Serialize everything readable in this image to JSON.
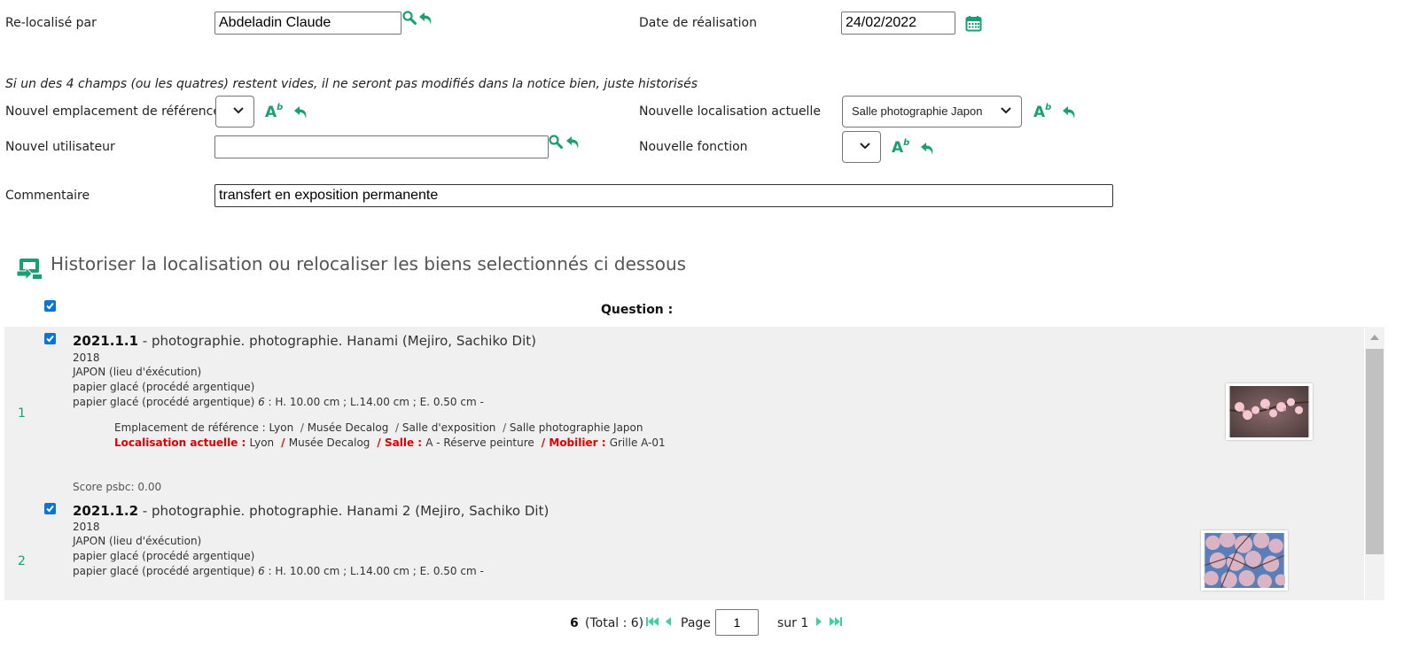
{
  "form": {
    "relocalise_label": "Re-localisé par",
    "relocalise_value": "Abdeladin Claude",
    "date_label": "Date de réalisation",
    "date_value": "24/02/2022",
    "note": "Si un des 4 champs (ou les quatres) restent vides, il ne seront pas modifiés dans la notice bien, juste historisés",
    "emplacement_label": "Nouvel emplacement de référence",
    "emplacement_value": "",
    "localisation_label": "Nouvelle localisation actuelle",
    "localisation_value": "Salle photographie Japon",
    "utilisateur_label": "Nouvel utilisateur",
    "utilisateur_value": "",
    "fonction_label": "Nouvelle fonction",
    "fonction_value": "",
    "commentaire_label": "Commentaire",
    "commentaire_value": "transfert en exposition permanente"
  },
  "section": {
    "title": "Historiser la localisation ou relocaliser les biens selectionnés ci dessous",
    "column_header": "Question :"
  },
  "items": [
    {
      "num": "1",
      "code": "2021.1.1",
      "desc": " - photographie. photographie. Hanami (Mejiro, Sachiko Dit)",
      "year": "2018",
      "place": "JAPON (lieu d'éxécution)",
      "material": "papier glacé (procédé argentique)",
      "dims_prefix": "papier glacé (procédé argentique) ",
      "dims_count": "6",
      "dims_rest": " : H. 10.00 cm ; L.14.00 cm ; E. 0.50 cm -",
      "ref_label": "Emplacement de référence : ",
      "ref_path": [
        "Lyon",
        "Musée Decalog",
        "Salle d'exposition",
        "Salle photographie Japon"
      ],
      "loc_label": "Localisation actuelle : ",
      "loc_city": "Lyon",
      "loc_museum": "Musée Decalog",
      "salle_label": "Salle : ",
      "salle_value": "A - Réserve peinture",
      "mobilier_label": "Mobilier : ",
      "mobilier_value": "Grille A-01",
      "score": "Score psbc: 0.00"
    },
    {
      "num": "2",
      "code": "2021.1.2",
      "desc": " - photographie. photographie. Hanami 2 (Mejiro, Sachiko Dit)",
      "year": "2018",
      "place": "JAPON (lieu d'éxécution)",
      "material": "papier glacé (procédé argentique)",
      "dims_prefix": "papier glacé (procédé argentique) ",
      "dims_count": "6",
      "dims_rest": " : H. 10.00 cm ; L.14.00 cm ; E. 0.50 cm -"
    }
  ],
  "pagination": {
    "count": "6",
    "total": "(Total : 6)",
    "page_label": "Page",
    "page_value": "1",
    "of_label": "sur 1"
  },
  "colors": {
    "accent": "#1a9f73",
    "alert": "#e00000",
    "checkbox": "#0a75d8"
  },
  "icons": [
    "search-icon",
    "undo-icon",
    "calendar-icon",
    "text-format-icon",
    "relocate-icon",
    "chevron-down-icon",
    "first-page-icon",
    "prev-page-icon",
    "next-page-icon",
    "last-page-icon"
  ]
}
